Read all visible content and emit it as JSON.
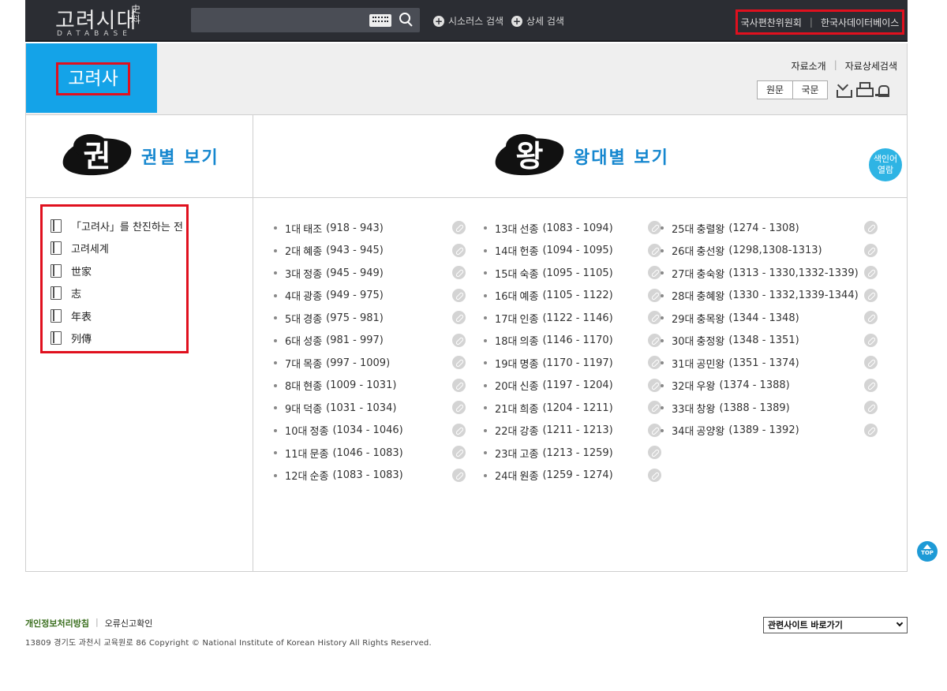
{
  "header": {
    "logo_main": "고려시대",
    "logo_hanja": "史料",
    "logo_sub": "DATABASE",
    "search_placeholder": "",
    "thesaurus_label": "시소러스 검색",
    "advanced_label": "상세 검색",
    "right_links": [
      "국사편찬위원회",
      "한국사데이터베이스"
    ]
  },
  "title_band": {
    "title": "고려사",
    "links": [
      "자료소개",
      "자료상세검색"
    ],
    "lang_options": [
      "원문",
      "국문"
    ]
  },
  "left_panel": {
    "glyph": "권",
    "heading": "권별 보기",
    "volumes": [
      "「고려사」를 찬진하는 전",
      "고려세계",
      "世家",
      "志",
      "年表",
      "列傳"
    ]
  },
  "right_panel": {
    "glyph": "왕",
    "heading": "왕대별 보기",
    "index_badge": "색인어\n열람",
    "columns": [
      [
        {
          "ord": "1대",
          "name": "태조",
          "years": "(918 - 943)"
        },
        {
          "ord": "2대",
          "name": "혜종",
          "years": "(943 - 945)"
        },
        {
          "ord": "3대",
          "name": "정종",
          "years": "(945 - 949)"
        },
        {
          "ord": "4대",
          "name": "광종",
          "years": "(949 - 975)"
        },
        {
          "ord": "5대",
          "name": "경종",
          "years": "(975 - 981)"
        },
        {
          "ord": "6대",
          "name": "성종",
          "years": "(981 - 997)"
        },
        {
          "ord": "7대",
          "name": "목종",
          "years": "(997 - 1009)"
        },
        {
          "ord": "8대",
          "name": "현종",
          "years": "(1009 - 1031)"
        },
        {
          "ord": "9대",
          "name": "덕종",
          "years": "(1031 - 1034)"
        },
        {
          "ord": "10대",
          "name": "정종",
          "years": "(1034 - 1046)"
        },
        {
          "ord": "11대",
          "name": "문종",
          "years": "(1046 - 1083)"
        },
        {
          "ord": "12대",
          "name": "순종",
          "years": "(1083 - 1083)"
        }
      ],
      [
        {
          "ord": "13대",
          "name": "선종",
          "years": "(1083 - 1094)"
        },
        {
          "ord": "14대",
          "name": "헌종",
          "years": "(1094 - 1095)"
        },
        {
          "ord": "15대",
          "name": "숙종",
          "years": "(1095 - 1105)"
        },
        {
          "ord": "16대",
          "name": "예종",
          "years": "(1105 - 1122)"
        },
        {
          "ord": "17대",
          "name": "인종",
          "years": "(1122 - 1146)"
        },
        {
          "ord": "18대",
          "name": "의종",
          "years": "(1146 - 1170)"
        },
        {
          "ord": "19대",
          "name": "명종",
          "years": "(1170 - 1197)"
        },
        {
          "ord": "20대",
          "name": "신종",
          "years": "(1197 - 1204)"
        },
        {
          "ord": "21대",
          "name": "희종",
          "years": "(1204 - 1211)"
        },
        {
          "ord": "22대",
          "name": "강종",
          "years": "(1211 - 1213)"
        },
        {
          "ord": "23대",
          "name": "고종",
          "years": "(1213 - 1259)"
        },
        {
          "ord": "24대",
          "name": "원종",
          "years": "(1259 - 1274)"
        }
      ],
      [
        {
          "ord": "25대",
          "name": "충렬왕",
          "years": "(1274 - 1308)"
        },
        {
          "ord": "26대",
          "name": "충선왕",
          "years": "(1298,1308-1313)"
        },
        {
          "ord": "27대",
          "name": "충숙왕",
          "years": "(1313 - 1330,1332-1339)"
        },
        {
          "ord": "28대",
          "name": "충혜왕",
          "years": "(1330 - 1332,1339-1344)"
        },
        {
          "ord": "29대",
          "name": "충목왕",
          "years": "(1344 - 1348)"
        },
        {
          "ord": "30대",
          "name": "충정왕",
          "years": "(1348 - 1351)"
        },
        {
          "ord": "31대",
          "name": "공민왕",
          "years": "(1351 - 1374)"
        },
        {
          "ord": "32대",
          "name": "우왕",
          "years": "(1374 - 1388)"
        },
        {
          "ord": "33대",
          "name": "창왕",
          "years": "(1388 - 1389)"
        },
        {
          "ord": "34대",
          "name": "공양왕",
          "years": "(1389 - 1392)"
        }
      ]
    ]
  },
  "top_button": "TOP",
  "footer": {
    "privacy": "개인정보처리방침",
    "error_report": "오류신고확인",
    "copyright": "13809 경기도 과천시 교육원로 86 Copyright © National Institute of Korean History All Rights Reserved.",
    "related_sites": "관련사이트 바로가기"
  },
  "colors": {
    "brand_blue": "#14a3e8",
    "heading_blue": "#1587cf",
    "highlight_red": "#e0101e",
    "header_dark": "#2b2d33"
  }
}
